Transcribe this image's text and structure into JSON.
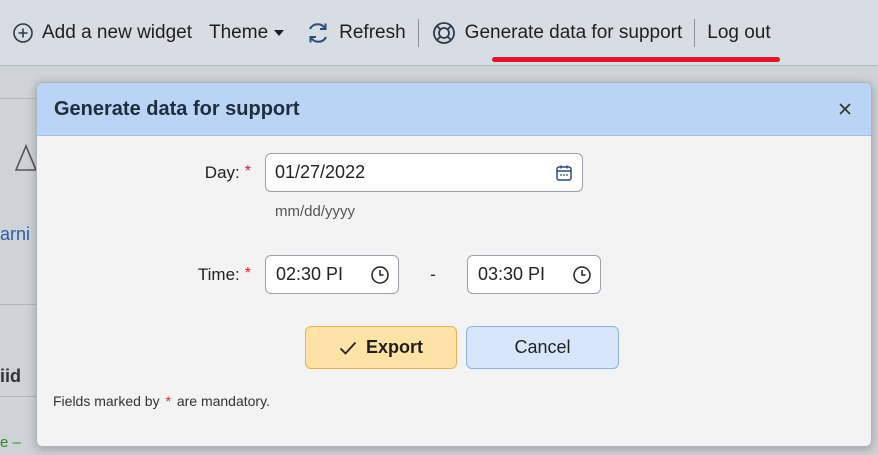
{
  "toolbar": {
    "add_widget": "Add a new widget",
    "theme": "Theme",
    "refresh": "Refresh",
    "generate": "Generate data for support",
    "logout": "Log out",
    "accent_color": "#e0142b"
  },
  "background": {
    "fragment_warn": "arni",
    "fragment_side": "iid",
    "fragment_bottom": "e –"
  },
  "dialog": {
    "title": "Generate data for support",
    "close_icon": "close-icon",
    "day": {
      "label": "Day:",
      "required_mark": "*",
      "value": "01/27/2022",
      "hint": "mm/dd/yyyy"
    },
    "time": {
      "label": "Time:",
      "required_mark": "*",
      "start": "02:30 PI",
      "separator": "-",
      "end": "03:30 PI"
    },
    "buttons": {
      "export": "Export",
      "cancel": "Cancel"
    },
    "footnote": {
      "before": "Fields marked by",
      "mark": "*",
      "after": "are mandatory."
    }
  }
}
